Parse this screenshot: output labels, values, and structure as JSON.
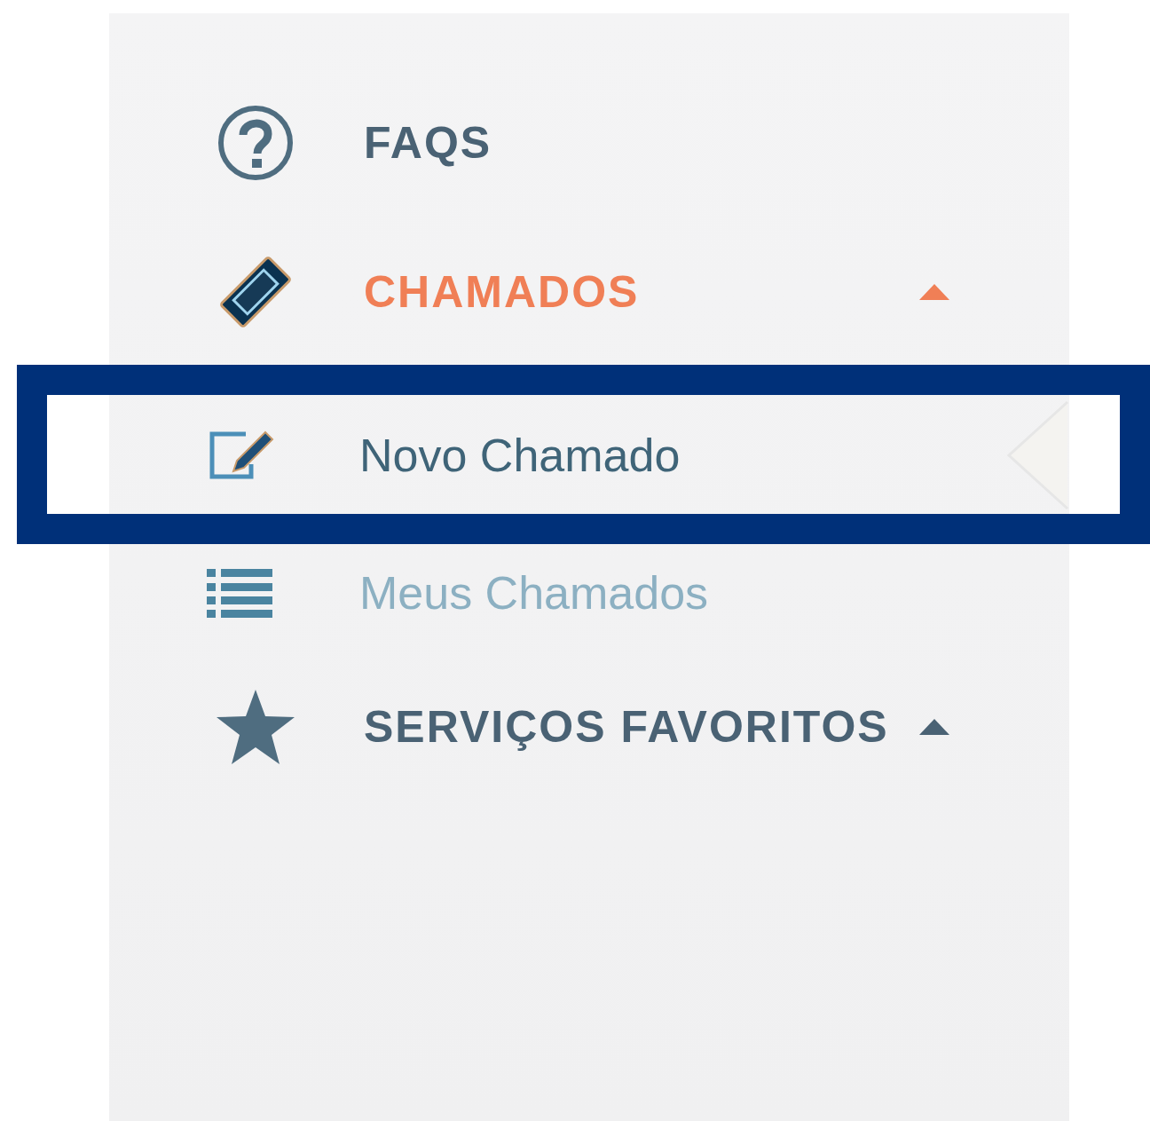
{
  "sidebar": {
    "items": [
      {
        "kind": "faq",
        "label": "FAQS",
        "selected": false
      },
      {
        "kind": "ticket",
        "label": "CHAMADOS",
        "selected": true,
        "expanded": true,
        "children": [
          {
            "kind": "edit",
            "label": "Novo Chamado",
            "selected": true,
            "highlighted": true
          },
          {
            "kind": "list",
            "label": "Meus Chamados",
            "selected": false,
            "highlighted": false
          }
        ]
      },
      {
        "kind": "star",
        "label": "SERVIÇOS FAVORITOS",
        "selected": false,
        "expanded": true
      }
    ]
  }
}
